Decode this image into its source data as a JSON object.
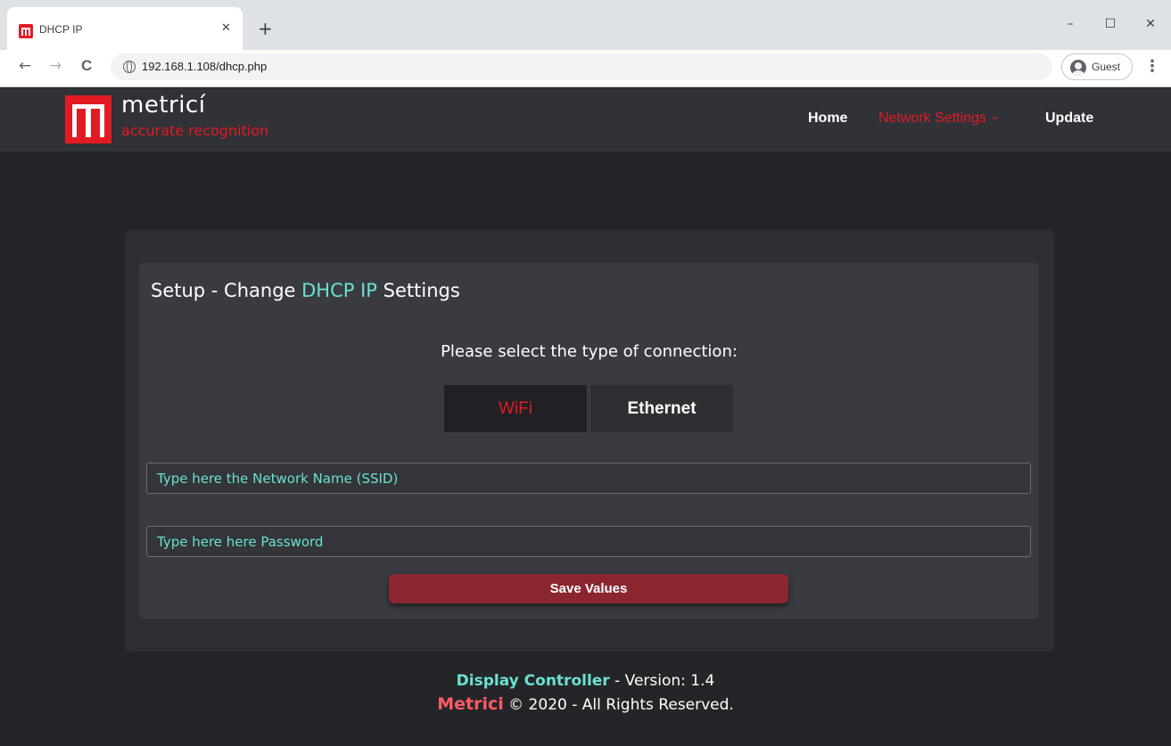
{
  "browser": {
    "tab_title": "DHCP IP",
    "tab_close": "✕",
    "new_tab": "+",
    "url": "192.168.1.108/dhcp.php",
    "profile_label": "Guest",
    "minimize": "–",
    "maximize": "☐",
    "close": "✕",
    "back": "←",
    "forward": "→",
    "reload": "C",
    "menu": "⋮"
  },
  "header": {
    "brand_name": "metricí",
    "brand_tagline": "accurate recognition",
    "nav": {
      "home": "Home",
      "network_settings": "Network Settings",
      "network_chevron": "⌄",
      "update": "Update"
    }
  },
  "card": {
    "title_prefix": "Setup - Change ",
    "title_accent": "DHCP IP",
    "title_suffix": " Settings",
    "prompt": "Please select the type of connection:",
    "options": {
      "wifi": "WiFi",
      "ethernet": "Ethernet"
    },
    "ssid_placeholder": "Type here the Network Name (SSID)",
    "password_placeholder": "Type here here Password",
    "save_label": "Save Values"
  },
  "footer": {
    "product": "Display Controller",
    "version_text": " - Version: 1.4",
    "company": "Metrici",
    "copyright": " © 2020 - All Rights Reserved."
  },
  "colors": {
    "brand_red": "#e21a22",
    "accent_teal": "#6be0d2",
    "save_button": "#8b2630",
    "page_bg": "#242528"
  },
  "icons": [
    "metrici-logo-icon",
    "globe-icon",
    "profile-icon",
    "chevron-down-icon",
    "close-icon",
    "plus-icon",
    "back-arrow-icon",
    "forward-arrow-icon",
    "reload-icon",
    "kebab-menu-icon"
  ]
}
